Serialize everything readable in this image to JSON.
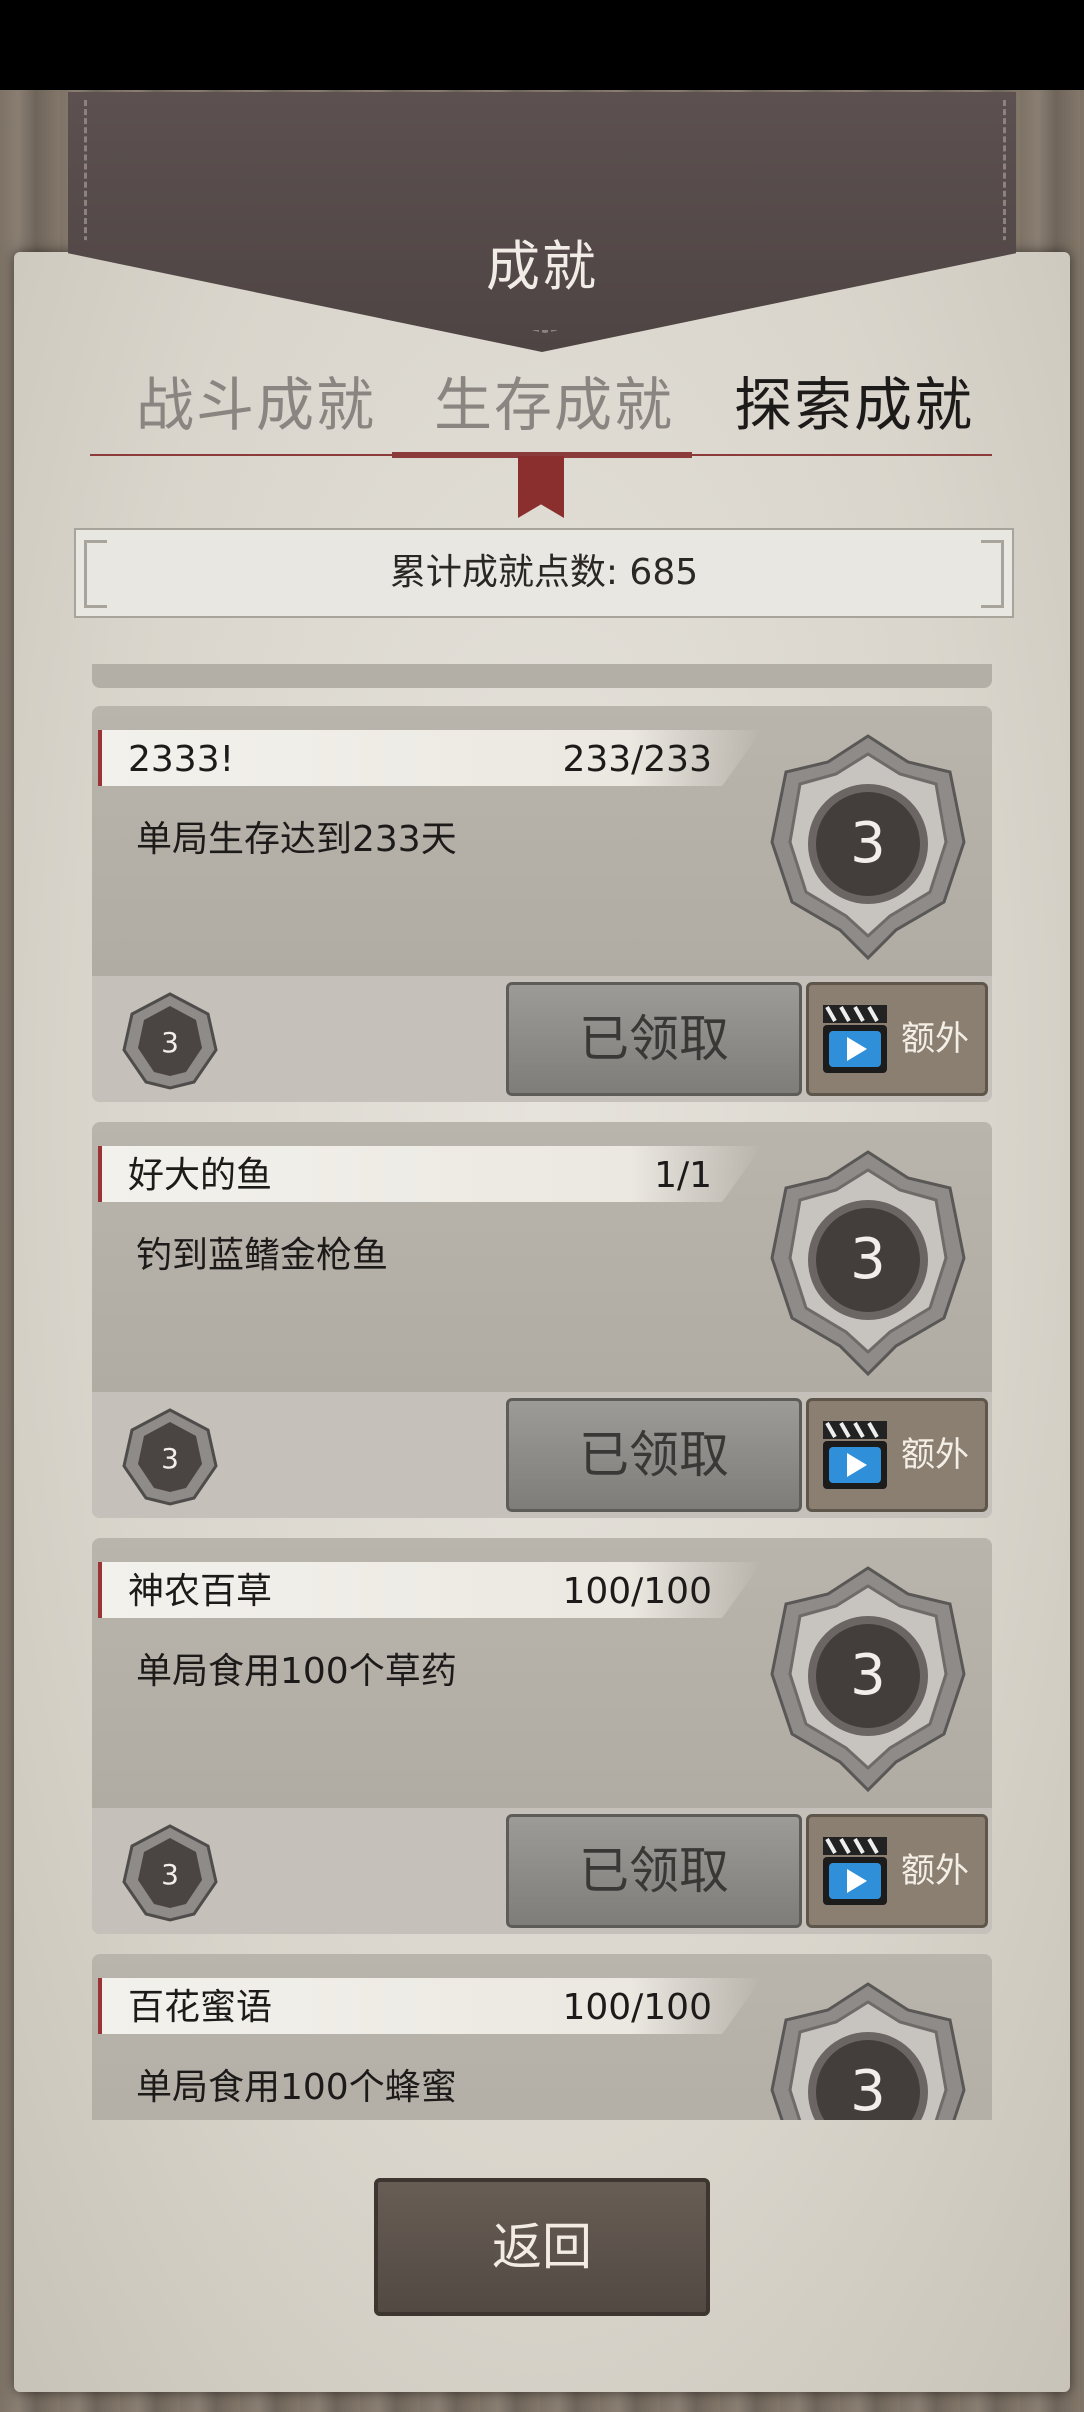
{
  "header": {
    "title": "成就"
  },
  "tabs": [
    {
      "label": "战斗成就",
      "active": false
    },
    {
      "label": "生存成就",
      "active": true
    },
    {
      "label": "探索成就",
      "active": false
    }
  ],
  "points": {
    "label": "累计成就点数: 685"
  },
  "achievements": [
    {
      "name": "2333!",
      "progress": "233/233",
      "description": "单局生存达到233天",
      "medal_level": "3",
      "badge_level": "3",
      "claim_label": "已领取",
      "extra_label": "额外"
    },
    {
      "name": "好大的鱼",
      "progress": "1/1",
      "description": "钓到蓝鳍金枪鱼",
      "medal_level": "3",
      "badge_level": "3",
      "claim_label": "已领取",
      "extra_label": "额外"
    },
    {
      "name": "神农百草",
      "progress": "100/100",
      "description": "单局食用100个草药",
      "medal_level": "3",
      "badge_level": "3",
      "claim_label": "已领取",
      "extra_label": "额外"
    },
    {
      "name": "百花蜜语",
      "progress": "100/100",
      "description": "单局食用100个蜂蜜",
      "medal_level": "3"
    }
  ],
  "footer": {
    "back_label": "返回"
  },
  "colors": {
    "accent_red": "#8c3b3b",
    "leather": "#544948",
    "paper": "#e0ddd5"
  }
}
